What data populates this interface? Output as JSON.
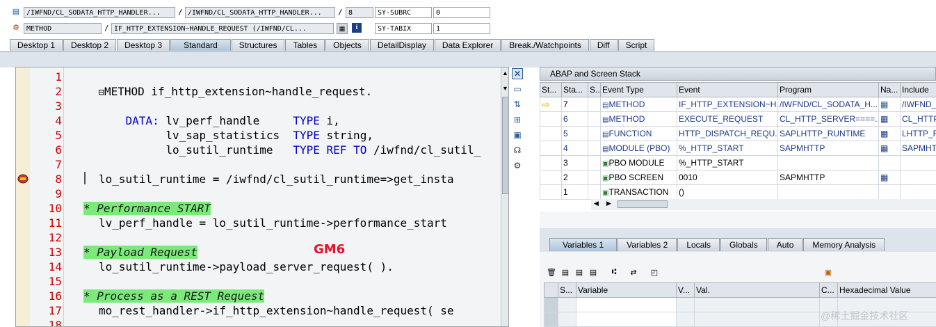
{
  "header": {
    "row1": {
      "field1": "/IWFND/CL_SODATA_HTTP_HANDLER...",
      "field2": "/IWFND/CL_SODATA_HTTP_HANDLER...",
      "line": "8",
      "sy_label": "SY-SUBRC",
      "sy_value": "0"
    },
    "row2": {
      "type": "METHOD",
      "name": "IF_HTTP_EXTENSION~HANDLE_REQUEST (/IWFND/CL...",
      "sy_label": "SY-TABIX",
      "sy_value": "1"
    },
    "slash": "/"
  },
  "tabs": [
    "Desktop 1",
    "Desktop 2",
    "Desktop 3",
    "Standard",
    "Structures",
    "Tables",
    "Objects",
    "DetailDisplay",
    "Data Explorer",
    "Break./Watchpoints",
    "Diff",
    "Script"
  ],
  "active_tab": "Standard",
  "code": {
    "line_numbers": [
      "1",
      "2",
      "3",
      "4",
      "5",
      "6",
      "7",
      "8",
      "9",
      "10",
      "11",
      "12",
      "13",
      "14",
      "15",
      "16",
      "17",
      "18"
    ],
    "l1": {
      "box": "⊟",
      "kw": "METHOD",
      "rest": " if_http_extension~handle_request."
    },
    "l3": {
      "kw1": "DATA:",
      "v": " lv_perf_handle     ",
      "kw2": "TYPE",
      "r": " i,"
    },
    "l4": {
      "v": "      lv_sap_statistics  ",
      "kw": "TYPE",
      "r": " string,"
    },
    "l5": {
      "v": "      lo_sutil_runtime   ",
      "kw1": "TYPE",
      "kw2": "REF",
      "kw3": "TO",
      "r": " /iwfnd/cl_sutil_"
    },
    "l8": "lo_sutil_runtime = /iwfnd/cl_sutil_runtime=>get_insta",
    "l10": "* Performance START",
    "l11": "lv_perf_handle = lo_sutil_runtime->performance_start",
    "l13": "* Payload Request",
    "l14": "lo_sutil_runtime->payload_server_request( ).",
    "l16": "* Process as a REST Request",
    "l17": "mo_rest_handler->if_http_extension~handle_request( se"
  },
  "annotation": {
    "text": "GM6",
    "color": "#e8102a"
  },
  "stack": {
    "title": "ABAP and Screen Stack",
    "columns": [
      "St...",
      "Sta...",
      "S...",
      "Event Type",
      "Event",
      "Program",
      "Na...",
      "Include"
    ],
    "rows": [
      {
        "level": "7",
        "type": "METHOD",
        "event": "IF_HTTP_EXTENSION~H...",
        "program": "/IWFND/CL_SODATA_H...",
        "include": "/IWFND_",
        "current": true
      },
      {
        "level": "6",
        "type": "METHOD",
        "event": "EXECUTE_REQUEST",
        "program": "CL_HTTP_SERVER====...",
        "include": "CL_HTTP_"
      },
      {
        "level": "5",
        "type": "FUNCTION",
        "event": "HTTP_DISPATCH_REQU...",
        "program": "SAPLHTTP_RUNTIME",
        "include": "LHTTP_R"
      },
      {
        "level": "4",
        "type": "MODULE (PBO)",
        "event": "%_HTTP_START",
        "program": "SAPMHTTP",
        "include": "SAPMHTT"
      },
      {
        "level": "3",
        "type": "PBO MODULE",
        "event": "%_HTTP_START",
        "program": "",
        "include": ""
      },
      {
        "level": "2",
        "type": "PBO SCREEN",
        "event": "0010",
        "program": "SAPMHTTP",
        "include": ""
      },
      {
        "level": "1",
        "type": "TRANSACTION",
        "event": "()",
        "program": "",
        "include": ""
      }
    ]
  },
  "var_tabs": [
    "Variables 1",
    "Variables 2",
    "Locals",
    "Globals",
    "Auto",
    "Memory Analysis"
  ],
  "var_grid": {
    "columns": [
      "S...",
      "Variable",
      "V...",
      "Val.",
      "C...",
      "Hexadecimal Value"
    ]
  },
  "watermark": "@稀土掘金技术社区"
}
